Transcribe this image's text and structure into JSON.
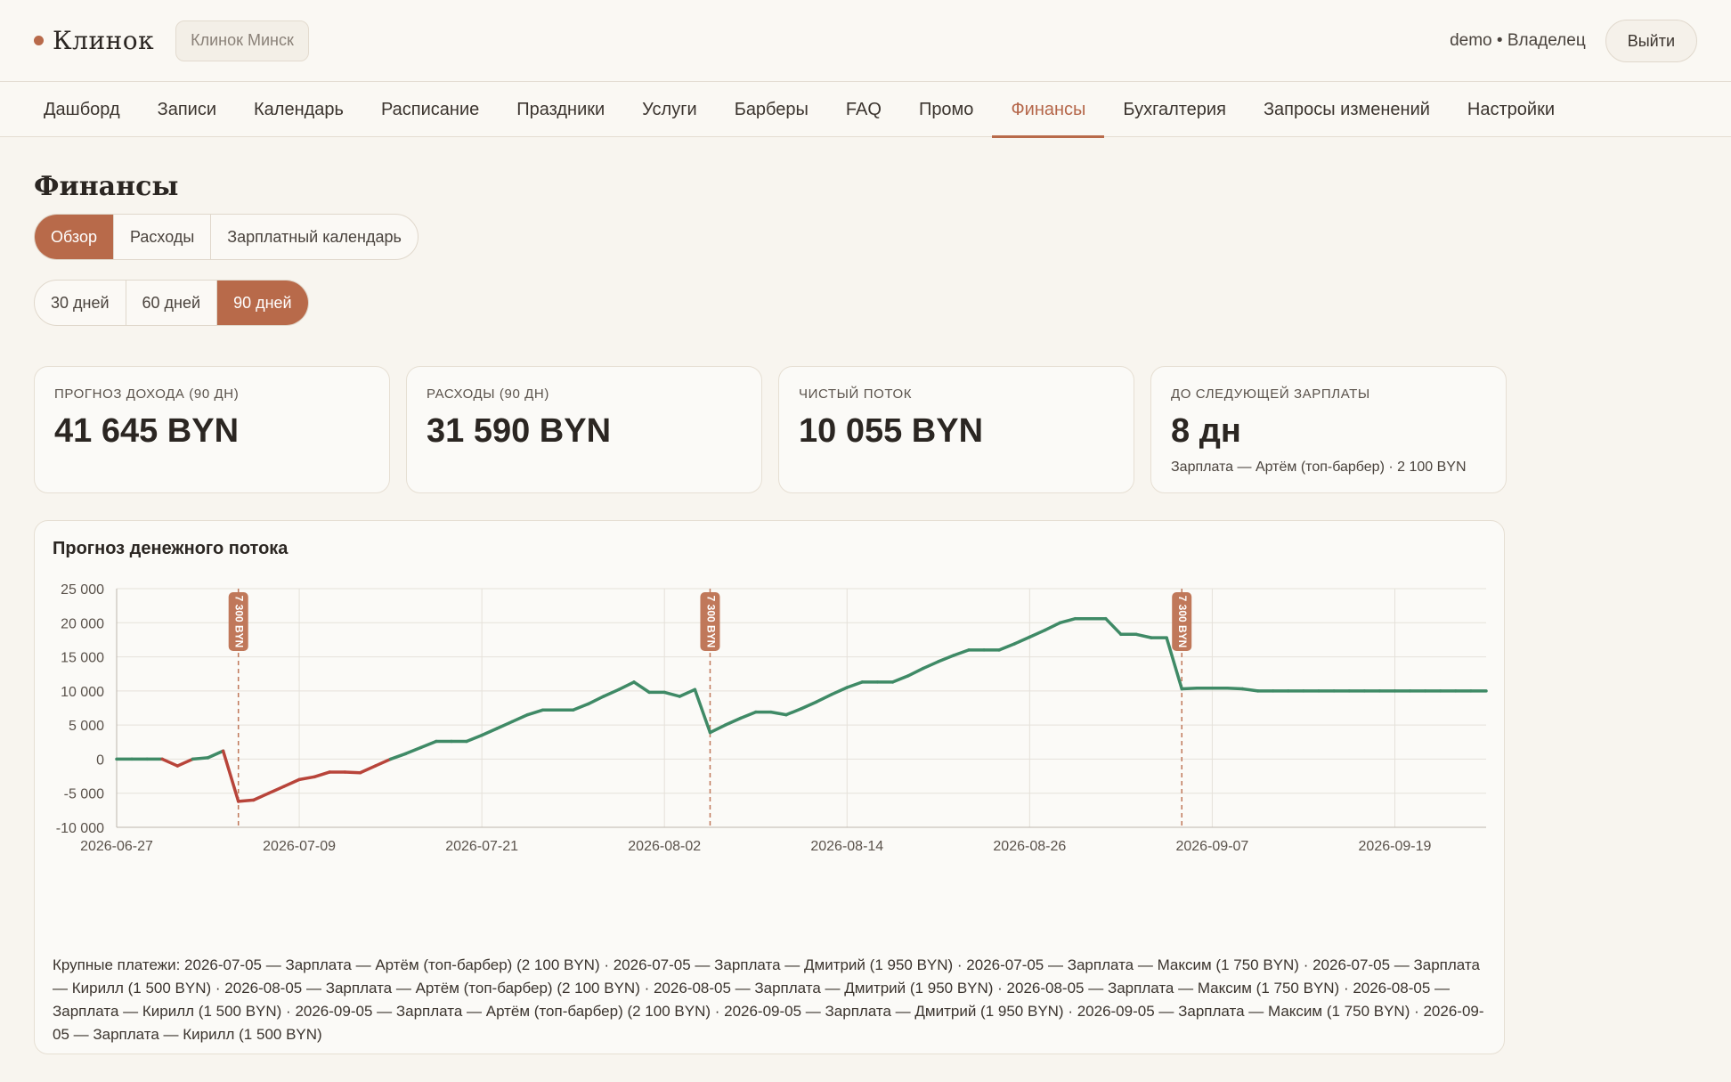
{
  "header": {
    "brand": "Клинок",
    "branch": "Клинок Минск",
    "user": "demo • Владелец",
    "logout": "Выйти"
  },
  "nav": [
    {
      "label": "Дашборд"
    },
    {
      "label": "Записи"
    },
    {
      "label": "Календарь"
    },
    {
      "label": "Расписание"
    },
    {
      "label": "Праздники"
    },
    {
      "label": "Услуги"
    },
    {
      "label": "Барберы"
    },
    {
      "label": "FAQ"
    },
    {
      "label": "Промо"
    },
    {
      "label": "Финансы",
      "active": true
    },
    {
      "label": "Бухгалтерия"
    },
    {
      "label": "Запросы изменений"
    },
    {
      "label": "Настройки"
    }
  ],
  "page": {
    "title": "Финансы",
    "tabs": [
      {
        "label": "Обзор",
        "active": true
      },
      {
        "label": "Расходы"
      },
      {
        "label": "Зарплатный календарь"
      }
    ],
    "periods": [
      {
        "label": "30 дней"
      },
      {
        "label": "60 дней"
      },
      {
        "label": "90 дней",
        "active": true
      }
    ]
  },
  "stats": [
    {
      "label": "Прогноз дохода (90 дн)",
      "value": "41 645 BYN",
      "sub": ""
    },
    {
      "label": "Расходы (90 дн)",
      "value": "31 590 BYN",
      "sub": ""
    },
    {
      "label": "Чистый поток",
      "value": "10 055 BYN",
      "sub": ""
    },
    {
      "label": "До следующей зарплаты",
      "value": "8 дн",
      "sub": "Зарплата — Артём (топ-барбер) · 2 100 BYN"
    }
  ],
  "chart_data": {
    "type": "line",
    "title": "Прогноз денежного потока",
    "ylim": [
      -10000,
      25000
    ],
    "yticks": [
      "25 000",
      "20 000",
      "15 000",
      "10 000",
      "5 000",
      "0",
      "-5 000",
      "-10 000"
    ],
    "xticks": [
      "2026-06-27",
      "2026-07-09",
      "2026-07-21",
      "2026-08-02",
      "2026-08-14",
      "2026-08-26",
      "2026-09-07",
      "2026-09-19"
    ],
    "x_start": "2026-06-27",
    "x_end": "2026-09-25",
    "grid": true,
    "colors": {
      "positive": "#3f8a66",
      "negative": "#b8443a",
      "marker": "#c0785a"
    },
    "series": [
      {
        "points": [
          [
            "2026-06-27",
            0
          ],
          [
            "2026-06-28",
            0
          ],
          [
            "2026-06-29",
            0
          ],
          [
            "2026-06-30",
            0
          ],
          [
            "2026-07-01",
            -1000
          ],
          [
            "2026-07-02",
            0
          ],
          [
            "2026-07-03",
            200
          ],
          [
            "2026-07-04",
            1200
          ],
          [
            "2026-07-05",
            -6200
          ],
          [
            "2026-07-06",
            -6000
          ],
          [
            "2026-07-07",
            -5000
          ],
          [
            "2026-07-08",
            -4000
          ],
          [
            "2026-07-09",
            -3000
          ],
          [
            "2026-07-10",
            -2600
          ],
          [
            "2026-07-11",
            -1900
          ],
          [
            "2026-07-12",
            -1900
          ],
          [
            "2026-07-13",
            -2000
          ],
          [
            "2026-07-14",
            -1000
          ],
          [
            "2026-07-15",
            0
          ],
          [
            "2026-07-16",
            800
          ],
          [
            "2026-07-17",
            1700
          ],
          [
            "2026-07-18",
            2600
          ],
          [
            "2026-07-19",
            2600
          ],
          [
            "2026-07-20",
            2600
          ],
          [
            "2026-07-21",
            3500
          ],
          [
            "2026-07-22",
            4500
          ],
          [
            "2026-07-23",
            5500
          ],
          [
            "2026-07-24",
            6500
          ],
          [
            "2026-07-25",
            7200
          ],
          [
            "2026-07-26",
            7200
          ],
          [
            "2026-07-27",
            7200
          ],
          [
            "2026-07-28",
            8100
          ],
          [
            "2026-07-29",
            9200
          ],
          [
            "2026-07-30",
            10200
          ],
          [
            "2026-07-31",
            11300
          ],
          [
            "2026-08-01",
            9800
          ],
          [
            "2026-08-02",
            9800
          ],
          [
            "2026-08-03",
            9200
          ],
          [
            "2026-08-04",
            10200
          ],
          [
            "2026-08-05",
            3900
          ],
          [
            "2026-08-06",
            5000
          ],
          [
            "2026-08-07",
            6000
          ],
          [
            "2026-08-08",
            6900
          ],
          [
            "2026-08-09",
            6900
          ],
          [
            "2026-08-10",
            6500
          ],
          [
            "2026-08-11",
            7400
          ],
          [
            "2026-08-12",
            8400
          ],
          [
            "2026-08-13",
            9500
          ],
          [
            "2026-08-14",
            10500
          ],
          [
            "2026-08-15",
            11300
          ],
          [
            "2026-08-16",
            11300
          ],
          [
            "2026-08-17",
            11300
          ],
          [
            "2026-08-18",
            12200
          ],
          [
            "2026-08-19",
            13300
          ],
          [
            "2026-08-20",
            14300
          ],
          [
            "2026-08-21",
            15200
          ],
          [
            "2026-08-22",
            16000
          ],
          [
            "2026-08-23",
            16000
          ],
          [
            "2026-08-24",
            16000
          ],
          [
            "2026-08-25",
            16900
          ],
          [
            "2026-08-26",
            17900
          ],
          [
            "2026-08-27",
            18900
          ],
          [
            "2026-08-28",
            20000
          ],
          [
            "2026-08-29",
            20600
          ],
          [
            "2026-08-30",
            20600
          ],
          [
            "2026-08-31",
            20600
          ],
          [
            "2026-09-01",
            18300
          ],
          [
            "2026-09-02",
            18300
          ],
          [
            "2026-09-03",
            17800
          ],
          [
            "2026-09-04",
            17800
          ],
          [
            "2026-09-05",
            10300
          ],
          [
            "2026-09-06",
            10400
          ],
          [
            "2026-09-07",
            10400
          ],
          [
            "2026-09-08",
            10400
          ],
          [
            "2026-09-09",
            10300
          ],
          [
            "2026-09-10",
            10000
          ],
          [
            "2026-09-11",
            10000
          ],
          [
            "2026-09-12",
            10000
          ],
          [
            "2026-09-13",
            10000
          ],
          [
            "2026-09-14",
            10000
          ],
          [
            "2026-09-15",
            10000
          ],
          [
            "2026-09-16",
            10000
          ],
          [
            "2026-09-17",
            10000
          ],
          [
            "2026-09-18",
            10000
          ],
          [
            "2026-09-19",
            10000
          ],
          [
            "2026-09-20",
            10000
          ],
          [
            "2026-09-21",
            10000
          ],
          [
            "2026-09-22",
            10000
          ],
          [
            "2026-09-23",
            10000
          ],
          [
            "2026-09-24",
            10000
          ],
          [
            "2026-09-25",
            10000
          ]
        ]
      }
    ],
    "markers": [
      {
        "date": "2026-07-05",
        "label": "7 300 BYN"
      },
      {
        "date": "2026-08-05",
        "label": "7 300 BYN"
      },
      {
        "date": "2026-09-05",
        "label": "7 300 BYN"
      }
    ]
  },
  "payments_note": "Крупные платежи: 2026-07-05 — Зарплата — Артём (топ-барбер) (2 100 BYN) · 2026-07-05 — Зарплата — Дмитрий (1 950 BYN) · 2026-07-05 — Зарплата — Максим (1 750 BYN) · 2026-07-05 — Зарплата — Кирилл (1 500 BYN) · 2026-08-05 — Зарплата — Артём (топ-барбер) (2 100 BYN) · 2026-08-05 — Зарплата — Дмитрий (1 950 BYN) · 2026-08-05 — Зарплата — Максим (1 750 BYN) · 2026-08-05 — Зарплата — Кирилл (1 500 BYN) · 2026-09-05 — Зарплата — Артём (топ-барбер) (2 100 BYN) · 2026-09-05 — Зарплата — Дмитрий (1 950 BYN) · 2026-09-05 — Зарплата — Максим (1 750 BYN) · 2026-09-05 — Зарплата — Кирилл (1 500 BYN)"
}
